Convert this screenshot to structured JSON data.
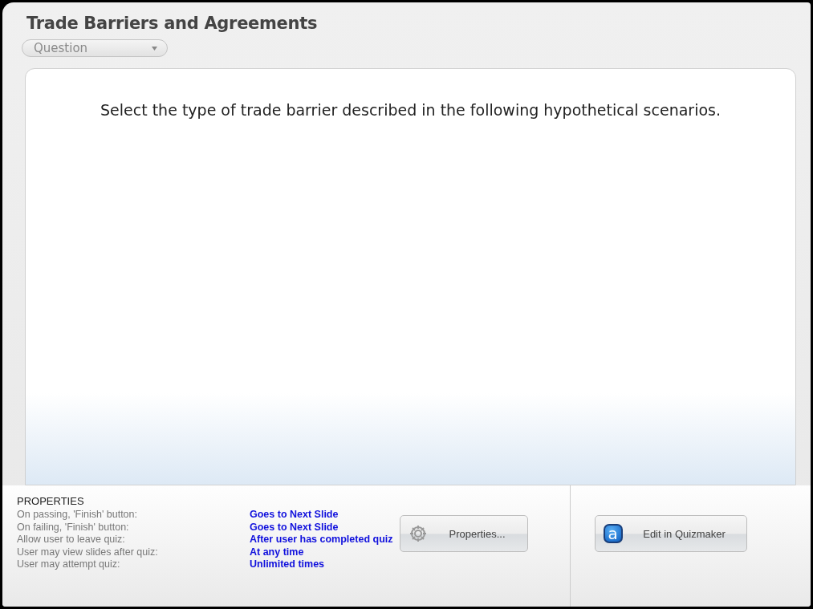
{
  "title": "Trade Barriers and Agreements",
  "slide_type_dropdown": {
    "value": "Question"
  },
  "slide": {
    "instruction": "Select the type of trade barrier described in the following hypothetical scenarios."
  },
  "properties": {
    "heading": "PROPERTIES",
    "rows": [
      {
        "label": "On passing, 'Finish' button:",
        "value": "Goes to Next Slide"
      },
      {
        "label": "On failing, 'Finish' button:",
        "value": "Goes to Next Slide"
      },
      {
        "label": "Allow user to leave quiz:",
        "value": "After user has completed quiz"
      },
      {
        "label": "User may view slides after quiz:",
        "value": "At any time"
      },
      {
        "label": "User may attempt quiz:",
        "value": "Unlimited times"
      }
    ]
  },
  "buttons": [
    {
      "kind": "gear",
      "label": "Properties..."
    },
    {
      "kind": "logo",
      "logo_letter": "a",
      "label": "Edit in Quizmaker"
    }
  ]
}
